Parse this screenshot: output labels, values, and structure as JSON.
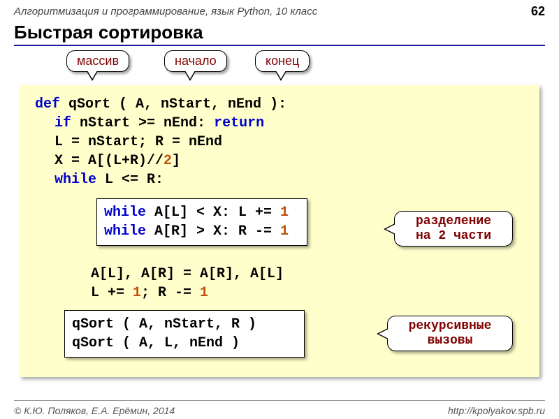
{
  "header": {
    "course": "Алгоритмизация и программирование, язык Python, 10 класс",
    "page": "62"
  },
  "title": "Быстрая сортировка",
  "top_callouts": {
    "arr": "массив",
    "start": "начало",
    "end": "конец"
  },
  "code": {
    "l1a": "def",
    "l1b": " qSort ( A, nStart, nEnd ):",
    "l2a": "if",
    "l2b": " nStart >= nEnd: ",
    "l2c": "return",
    "l3": "L = nStart;  R = nEnd",
    "l4a": "X = A[(L+R)//",
    "l4b": "2",
    "l4c": "]",
    "l5a": "while",
    "l5b": " L <= R:",
    "l6": "A[L], A[R] = A[R], A[L]",
    "l7a": "L += ",
    "l7b": "1",
    "l7c": "; R -= ",
    "l7d": "1"
  },
  "inner1": {
    "a1": "while",
    "a2": " A[L] < X:  L += ",
    "a3": "1",
    "b1": "while",
    "b2": " A[R] > X:  R -= ",
    "b3": "1"
  },
  "inner2": {
    "a": "qSort ( A, nStart, R )",
    "b": "qSort ( A, L, nEnd )"
  },
  "right_callouts": {
    "split1": "разделение",
    "split2": "на 2 части",
    "rec1": "рекурсивные",
    "rec2": "вызовы"
  },
  "footer": {
    "left": "© К.Ю. Поляков, Е.А. Ерёмин, 2014",
    "right": "http://kpolyakov.spb.ru"
  }
}
